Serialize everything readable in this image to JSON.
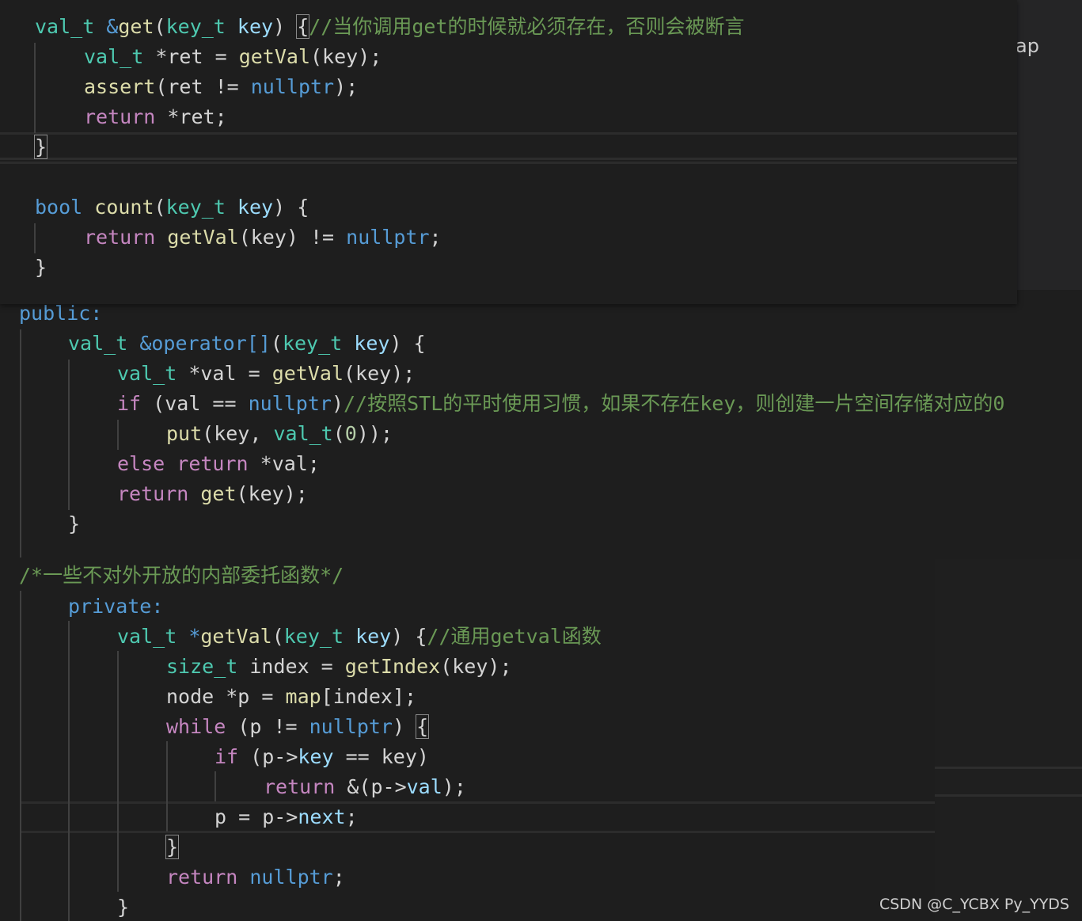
{
  "tab_fragment": "ap",
  "watermark": "CSDN @C_YCBX Py_YYDS",
  "code": {
    "l1": {
      "t1": "val_t",
      "t2": " &",
      "t3": "get",
      "t4": "(",
      "t5": "key_t",
      "t6": " ",
      "t7": "key",
      "t8": ") ",
      "t9": "{",
      "t10": "//当你调用get的时候就必须存在，否则会被断言"
    },
    "l2": {
      "t1": "val_t",
      "t2": " *ret = ",
      "t3": "getVal",
      "t4": "(key);"
    },
    "l3": {
      "t1": "assert",
      "t2": "(ret != ",
      "t3": "nullptr",
      "t4": ");"
    },
    "l4": {
      "t1": "return",
      "t2": " *ret;"
    },
    "l5": {
      "t1": "}"
    },
    "l6": {
      "t1": "bool",
      "t2": " ",
      "t3": "count",
      "t4": "(",
      "t5": "key_t",
      "t6": " ",
      "t7": "key",
      "t8": ") {"
    },
    "l7": {
      "t1": "return",
      "t2": " ",
      "t3": "getVal",
      "t4": "(key) != ",
      "t5": "nullptr",
      "t6": ";"
    },
    "l8": {
      "t1": "}"
    },
    "l9": {
      "t1": "public:"
    },
    "l10": {
      "t1": "val_t",
      "t2": " &",
      "t3": "operator[]",
      "t4": "(",
      "t5": "key_t",
      "t6": " ",
      "t7": "key",
      "t8": ") {"
    },
    "l11": {
      "t1": "val_t",
      "t2": " *val = ",
      "t3": "getVal",
      "t4": "(key);"
    },
    "l12": {
      "t1": "if",
      "t2": " (val == ",
      "t3": "nullptr",
      "t4": ")",
      "t5": "//按照STL的平时使用习惯，如果不存在key，则创建一片空间存储对应的0"
    },
    "l13": {
      "t1": "put",
      "t2": "(key, ",
      "t3": "val_t",
      "t4": "(",
      "t5": "0",
      "t6": "));"
    },
    "l14": {
      "t1": "else",
      "t2": " ",
      "t3": "return",
      "t4": " *val;"
    },
    "l15": {
      "t1": "return",
      "t2": " ",
      "t3": "get",
      "t4": "(key);"
    },
    "l16": {
      "t1": "}"
    },
    "l17": {
      "t1": "/*一些不对外开放的内部委托函数*/"
    },
    "l18": {
      "t1": "private:"
    },
    "l19": {
      "t1": "val_t",
      "t2": " *",
      "t3": "getVal",
      "t4": "(",
      "t5": "key_t",
      "t6": " ",
      "t7": "key",
      "t8": ") {",
      "t9": "//通用getval函数"
    },
    "l20": {
      "t1": "size_t",
      "t2": " index = ",
      "t3": "getIndex",
      "t4": "(key);"
    },
    "l21": {
      "t1": "node *p = ",
      "t2": "map",
      "t3": "[index];"
    },
    "l22": {
      "t1": "while",
      "t2": " (p != ",
      "t3": "nullptr",
      "t4": ") ",
      "t5": "{"
    },
    "l23": {
      "t1": "if",
      "t2": " (p->",
      "t3": "key",
      "t4": " == key)"
    },
    "l24": {
      "t1": "return",
      "t2": " &(p->",
      "t3": "val",
      "t4": ");"
    },
    "l25": {
      "t1": "p = p->",
      "t2": "next",
      "t3": ";"
    },
    "l26": {
      "t1": "}"
    },
    "l27": {
      "t1": "return",
      "t2": " ",
      "t3": "nullptr",
      "t4": ";"
    },
    "l28": {
      "t1": "}"
    }
  }
}
